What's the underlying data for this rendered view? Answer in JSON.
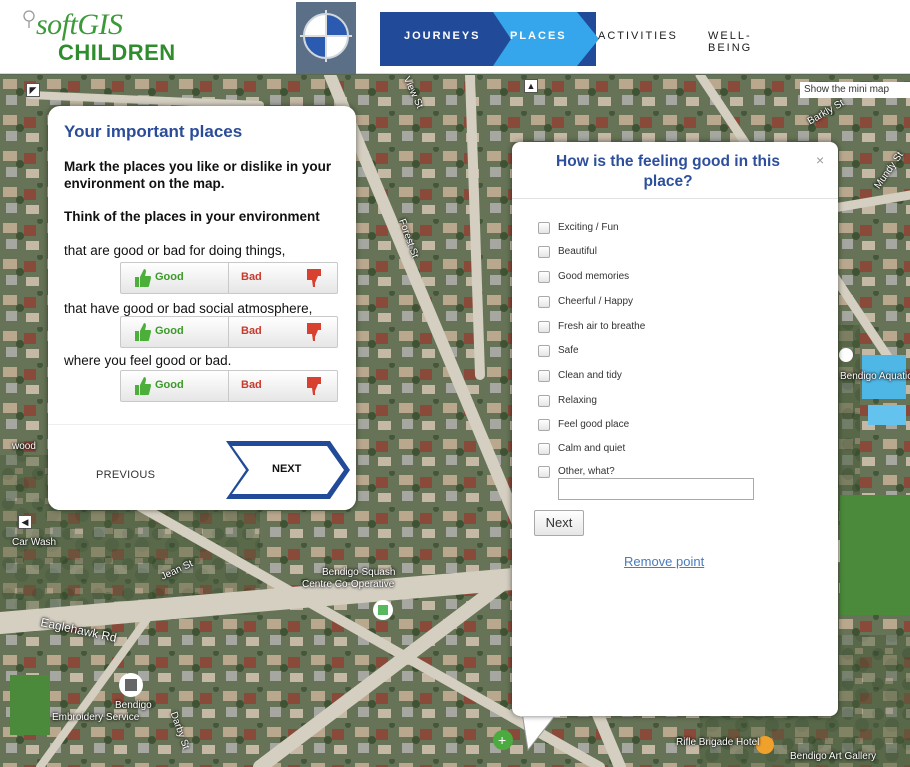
{
  "header": {
    "logo_soft": "softGIS",
    "logo_children": "CHILDREN",
    "nav": {
      "journeys": "JOURNEYS",
      "places": "PLACES",
      "activities": "ACTIVITIES",
      "wellbeing": "WELL-BEING"
    }
  },
  "map": {
    "minimap_label": "Show the mini map",
    "labels": {
      "view_st": "View St",
      "forest_st": "Forest St",
      "barkly_st": "Barkly St",
      "mundy_st": "Mundy St",
      "jean_st": "Jean St",
      "eaglehawk_rd": "Eaglehawk Rd",
      "car_wash": "Car Wash",
      "bendigo_squash": "Bendigo Squash",
      "centre_co_operative": "Centre Co-Operative",
      "bendigo_embroidery_1": "Bendigo",
      "bendigo_embroidery_2": "Embroidery Service",
      "bendigo_aquatic": "Bendigo Aquatic",
      "rifle_brigade": "Rifle Brigade Hotel",
      "bendigo_art": "Bendigo Art Gallery",
      "wood": "wood",
      "darby_st": "Darby St"
    },
    "colors": {
      "road": "#d9d4c6",
      "pool": "#4fb7e6",
      "park": "#4a8a3a"
    }
  },
  "left_panel": {
    "title": "Your important places",
    "intro": "Mark the places you like or dislike in your environment on the map.",
    "think": "Think of the places in your environment",
    "rows": [
      {
        "prompt": "that are good or bad for doing things,",
        "good": "Good",
        "bad": "Bad"
      },
      {
        "prompt": "that have good or bad social atmosphere,",
        "good": "Good",
        "bad": "Bad"
      },
      {
        "prompt": "where you feel good or bad.",
        "good": "Good",
        "bad": "Bad"
      }
    ],
    "previous": "PREVIOUS",
    "next": "NEXT",
    "colors": {
      "title": "#2b4d99",
      "good": "#3c9a2a",
      "bad": "#c63a2c",
      "nav": "#214b99"
    }
  },
  "popup": {
    "title": "How is the feeling good in this place?",
    "close": "×",
    "options": [
      "Exciting / Fun",
      "Beautiful",
      "Good memories",
      "Cheerful / Happy",
      "Fresh air to breathe",
      "Safe",
      "Clean and tidy",
      "Relaxing",
      "Feel good place",
      "Calm and quiet",
      "Other, what?"
    ],
    "other_value": "",
    "next": "Next",
    "remove": "Remove point"
  }
}
